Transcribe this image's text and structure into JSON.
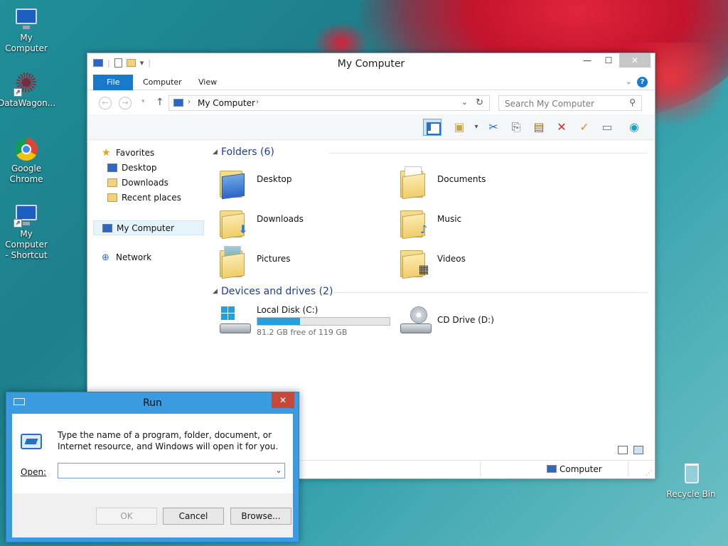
{
  "desktop": {
    "icons": [
      {
        "label": "My Computer"
      },
      {
        "label": "DataWagon..."
      },
      {
        "label": "Google\nChrome"
      },
      {
        "label": "My Computer\n- Shortcut"
      },
      {
        "label": "Recycle Bin"
      }
    ]
  },
  "explorer": {
    "title": "My Computer",
    "ribbon_tabs": [
      "File",
      "Computer",
      "View"
    ],
    "help_label": "?",
    "address": {
      "crumb": "My Computer"
    },
    "search": {
      "placeholder": "Search My Computer"
    },
    "nav_pane": {
      "favorites": "Favorites",
      "desktop": "Desktop",
      "downloads": "Downloads",
      "recent_places": "Recent places",
      "my_computer": "My Computer",
      "network": "Network"
    },
    "folders_group": "Folders (6)",
    "folders": [
      "Desktop",
      "Documents",
      "Downloads",
      "Music",
      "Pictures",
      "Videos"
    ],
    "devices_group": "Devices and drives (2)",
    "drives": {
      "local": {
        "name": "Local Disk (C:)",
        "free": "81.2 GB free of 119 GB",
        "used_fraction": 0.32
      },
      "cd": {
        "name": "CD Drive (D:)"
      }
    },
    "status": {
      "item": "Computer"
    }
  },
  "run": {
    "title": "Run",
    "description": "Type the name of a program, folder, document, or Internet resource, and Windows will open it for you.",
    "open_label": "Open:",
    "input_value": "",
    "ok": "OK",
    "cancel": "Cancel",
    "browse": "Browse..."
  },
  "colors": {
    "accent": "#1979ca",
    "drive_fill": "#26a0da",
    "run_frame": "#3b9be0"
  }
}
